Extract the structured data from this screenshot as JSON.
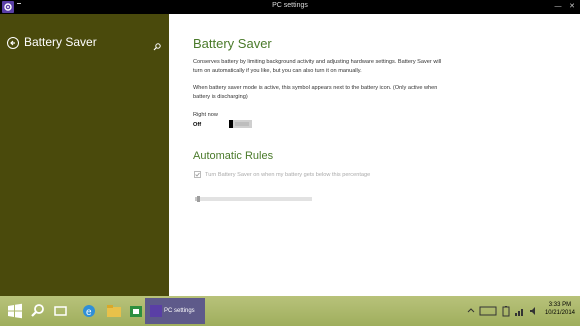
{
  "window": {
    "title": "PC settings"
  },
  "sidebar": {
    "title": "Battery Saver"
  },
  "main": {
    "heading": "Battery Saver",
    "description": "Conserves battery by limiting background activity and adjusting hardware settings. Battery Saver will turn on automatically if you like, but you can also turn it on manually.",
    "note": "When battery saver mode is active, this symbol appears next to the battery icon. (Only active when battery is discharging)",
    "right_now_label": "Right now",
    "toggle_state": "Off",
    "toggle_on": false,
    "rules_heading": "Automatic Rules",
    "rule_checkbox_label": "Turn Battery Saver on when my battery gets below this percentage",
    "rule_checked": true,
    "rule_enabled": false,
    "threshold_percent": 2
  },
  "taskbar": {
    "active_app_label": "PC settings",
    "time": "3:33 PM",
    "date": "10/21/2014"
  },
  "colors": {
    "sidebar": "#4a4a0c",
    "accent": "#4a7a2a",
    "taskbar": "#a9b66a",
    "app_icon": "#5a3fa6"
  }
}
